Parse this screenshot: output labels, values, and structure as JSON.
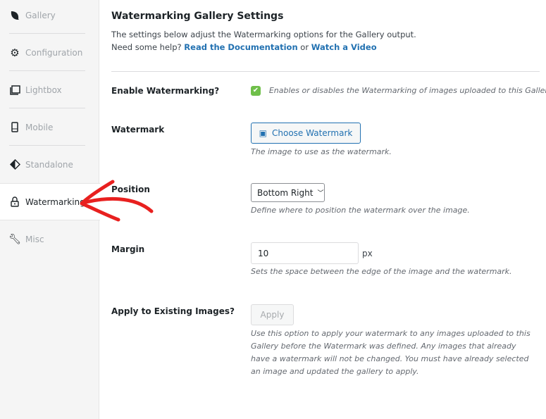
{
  "sidebar": {
    "items": [
      {
        "label": "Gallery",
        "icon": "leaf-icon"
      },
      {
        "label": "Configuration",
        "icon": "gear-icon"
      },
      {
        "label": "Lightbox",
        "icon": "lightbox-icon"
      },
      {
        "label": "Mobile",
        "icon": "mobile-icon"
      },
      {
        "label": "Standalone",
        "icon": "standalone-icon"
      },
      {
        "label": "Watermarking",
        "icon": "lock-icon",
        "active": true
      },
      {
        "label": "Misc",
        "icon": "wrench-icon"
      }
    ]
  },
  "main": {
    "title": "Watermarking Gallery Settings",
    "intro_line1": "The settings below adjust the Watermarking options for the Gallery output.",
    "intro_help": "Need some help?",
    "doc_link": "Read the Documentation",
    "or": "or",
    "video_link": "Watch a Video",
    "enable": {
      "label": "Enable Watermarking?",
      "checked": true,
      "desc": "Enables or disables the Watermarking of images uploaded to this Gallery."
    },
    "watermark": {
      "label": "Watermark",
      "button": "Choose Watermark",
      "desc": "The image to use as the watermark."
    },
    "position": {
      "label": "Position",
      "value": "Bottom Right",
      "desc": "Define where to position the watermark over the image."
    },
    "margin": {
      "label": "Margin",
      "value": "10",
      "unit": "px",
      "desc": "Sets the space between the edge of the image and the watermark."
    },
    "apply": {
      "label": "Apply to Existing Images?",
      "button": "Apply",
      "desc": "Use this option to apply your watermark to any images uploaded to this Gallery before the Watermark was defined. Any images that already have a watermark will not be changed. You must have already selected an image and updated the gallery to apply."
    }
  },
  "colors": {
    "accent": "#2271b1",
    "checkbox": "#6fbf4a",
    "annotation": "#e8201f"
  }
}
